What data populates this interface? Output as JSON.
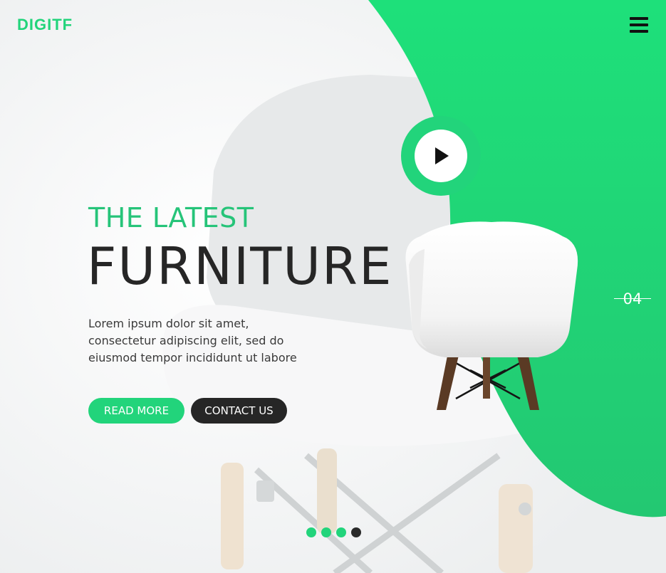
{
  "brand": {
    "logo": "DIGITF"
  },
  "colors": {
    "accent": "#22d47b",
    "dark": "#262626",
    "background": "#f3f4f5"
  },
  "header": {
    "menu_icon": "hamburger-menu-icon"
  },
  "hero": {
    "eyebrow": "THE LATEST",
    "headline": "FURNITURE",
    "description": "Lorem ipsum dolor sit amet, consectetur adipiscing elit, sed do eiusmod tempor incididunt ut labore",
    "buttons": {
      "read_more": "READ MORE",
      "contact": "CONTACT US"
    },
    "play_icon": "play-icon"
  },
  "slider": {
    "current_number": "04",
    "dots": [
      {
        "active": false
      },
      {
        "active": false
      },
      {
        "active": false
      },
      {
        "active": true
      }
    ]
  }
}
